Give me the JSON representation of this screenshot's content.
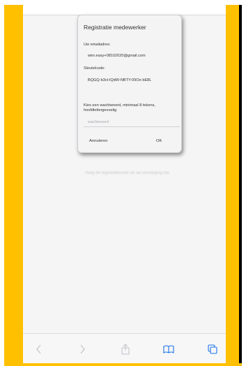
{
  "dialog": {
    "title": "Registratie medewerker",
    "email_label": "Uw emailadres:",
    "email_value": "wim.easy+08102020@gmail.com",
    "key_label": "Sleutelcode:",
    "key_value": "BQGQ-b3ct-lQdW-NBTY-09Ox-bE8L",
    "password_instruction": "Kies een wachtwoord, minimaal 8 tekens, hoofdlettergevoelig",
    "password_placeholder": "wachtwoord",
    "cancel_label": "Annuleren",
    "ok_label": "OK"
  },
  "background": {
    "hint_text": "Voeg de registratiecode uit uw uitnodiging toe."
  },
  "toolbar": {
    "icons": [
      "back-icon",
      "forward-icon",
      "share-icon",
      "bookmarks-icon",
      "tabs-icon"
    ],
    "accent_color": "#1a73e8",
    "disabled_color": "#c2c2c7"
  },
  "frame": {
    "border_color": "#ffc000"
  }
}
